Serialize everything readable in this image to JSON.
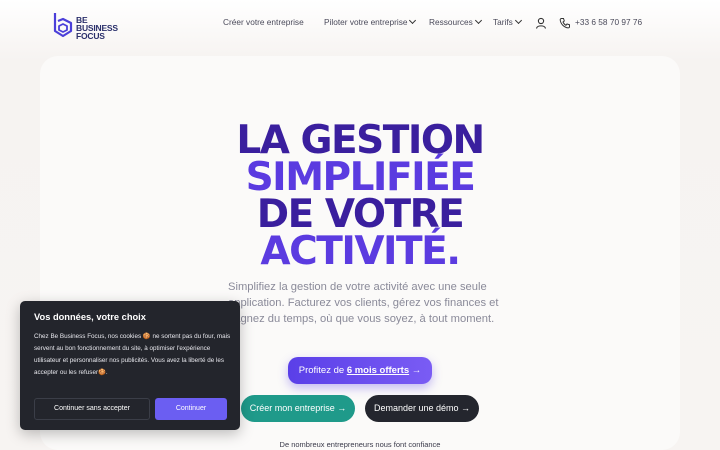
{
  "header": {
    "logo_lines": [
      "BE",
      "BUSINESS",
      "FOCUS"
    ],
    "nav": {
      "create": "Créer votre entreprise",
      "pilot": "Piloter votre entreprise",
      "resources": "Ressources",
      "pricing": "Tarifs"
    },
    "account_icon": "user-icon",
    "phone_icon": "phone-icon",
    "phone": "+33 6 58 70 97 76"
  },
  "hero": {
    "line1": "LA GESTION",
    "line2": "SIMPLIFIÉE",
    "line3": "DE VOTRE",
    "line4": "ACTIVITÉ.",
    "subtext": "Simplifiez la gestion de votre activité avec une seule application. Facturez vos clients, gérez vos finances et gagnez du temps, où que vous soyez, à tout moment.",
    "promo_prefix": "Profitez de",
    "promo_highlight": "6 mois offerts",
    "promo_arrow": "→",
    "cta_create": "Créer mon entreprise →",
    "cta_demo": "Demander une démo →",
    "trust": "De nombreux entrepreneurs nous font confiance"
  },
  "cookie": {
    "title": "Vos données, votre choix",
    "text": "Chez Be Business Focus, nos cookies 🍪 ne sortent pas du four, mais servent au bon fonctionnement du site, à optimiser l'expérience utilisateur et personnaliser nos publicités. Vous avez la liberté de les accepter ou les refuser🍪.",
    "decline": "Continuer sans accepter",
    "accept": "Continuer"
  },
  "colors": {
    "headline_dark": "#3a1f9e",
    "headline_light": "#5b3be0",
    "teal": "#1f9a8a",
    "cookie_bg": "#23252c",
    "accept": "#6b5ef2"
  }
}
